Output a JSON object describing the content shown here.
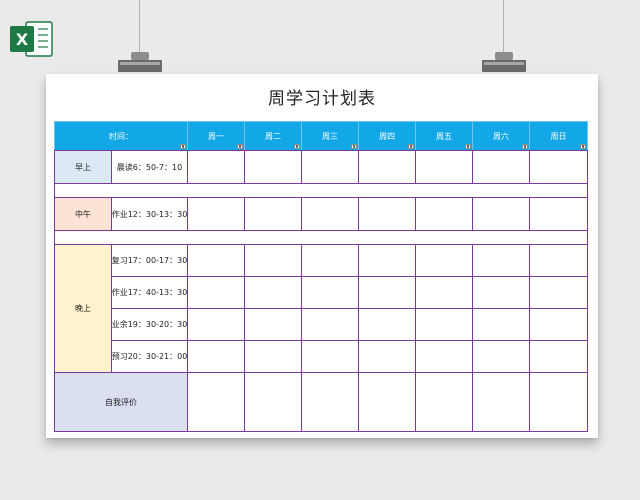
{
  "logo": {
    "icon": "excel-icon",
    "letter": "X"
  },
  "sheet": {
    "title": "周学习计划表",
    "header": {
      "time_label": "时间：",
      "days": [
        "周一",
        "周二",
        "周三",
        "周四",
        "周五",
        "周六",
        "周日"
      ]
    },
    "sections": {
      "morning": {
        "label": "早上",
        "activity": "晨读6：50-7：10"
      },
      "noon": {
        "label": "中午",
        "activity": "作业12：30-13：30"
      },
      "evening": {
        "label": "晚上",
        "activities": [
          "复习17：00-17：30",
          "作业17：40-13：30",
          "业余19：30-20：30",
          "预习20：30-21：00"
        ]
      },
      "self_eval": {
        "label": "自我评价"
      }
    }
  },
  "colors": {
    "header_bg": "#12a8e8",
    "grid_line": "#7a3a9c",
    "morning_bg": "#dce9f5",
    "noon_bg": "#fbe3d6",
    "evening_bg": "#fff2cc",
    "self_eval_bg": "#dae0f2"
  }
}
